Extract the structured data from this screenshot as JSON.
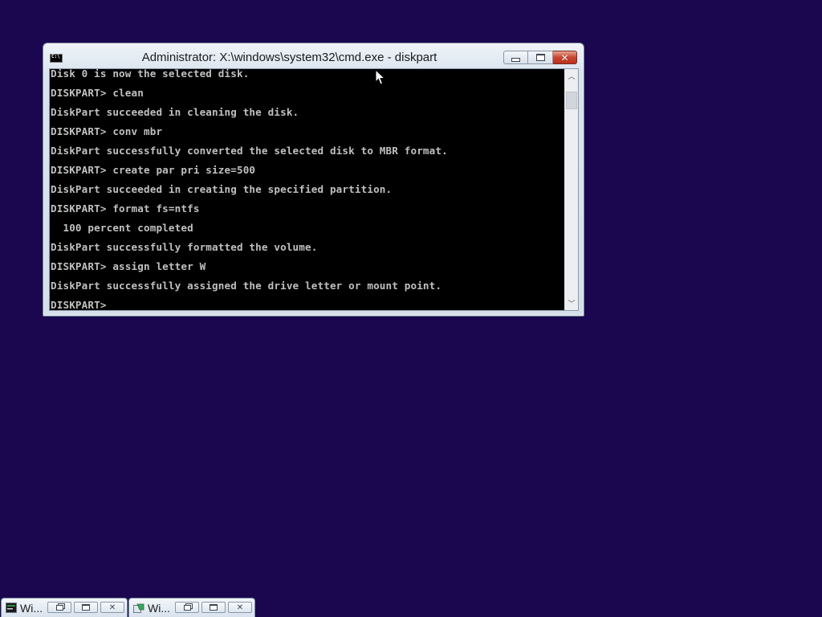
{
  "window": {
    "title": "Administrator: X:\\windows\\system32\\cmd.exe - diskpart",
    "close_glyph": "✕"
  },
  "console": {
    "lines": [
      "Disk 0 is now the selected disk.",
      "DISKPART> clean",
      "DiskPart succeeded in cleaning the disk.",
      "DISKPART> conv mbr",
      "DiskPart successfully converted the selected disk to MBR format.",
      "DISKPART> create par pri size=500",
      "DiskPart succeeded in creating the specified partition.",
      "DISKPART> format fs=ntfs",
      "  100 percent completed",
      "DiskPart successfully formatted the volume.",
      "DISKPART> assign letter W",
      "DiskPart successfully assigned the drive letter or mount point.",
      "DISKPART> "
    ]
  },
  "scrollbar": {
    "up_glyph": "︿",
    "down_glyph": "﹀"
  },
  "minimized_windows": [
    {
      "title": "Wi...",
      "icon": "cmd-window-icon"
    },
    {
      "title": "Wi...",
      "icon": "setup-window-icon"
    }
  ],
  "colors": {
    "desktop": "#1b0750",
    "console_bg": "#000000",
    "console_text": "#c0c0c0",
    "close_button": "#c7452e"
  }
}
